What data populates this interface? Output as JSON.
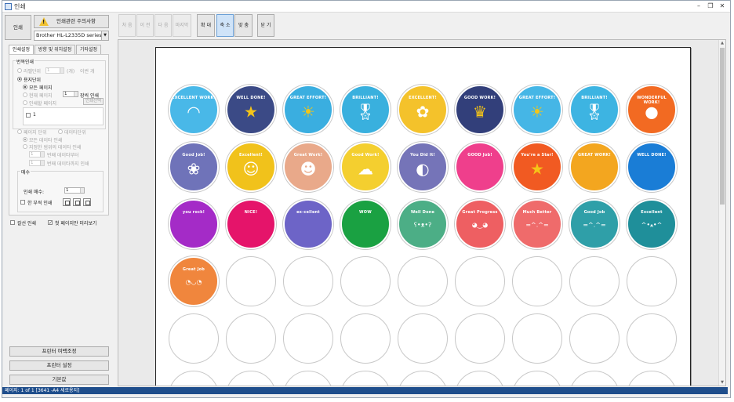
{
  "window": {
    "title": "인쇄",
    "controls": [
      "–",
      "❐",
      "✕"
    ]
  },
  "left": {
    "print_label": "인쇄",
    "notice_label": "인쇄관련 주의사항",
    "printer": "Brother HL-L2335D series[",
    "tabs": [
      "인쇄설정",
      "방향 및 위치설정",
      "기타설정"
    ],
    "range_group": "번복인쇄",
    "label_unit": "라벨단위",
    "label_unit_value": "1",
    "label_unit_suffix": "(개)",
    "label_unit_extra": "이번 개",
    "sheet_unit": "용지단위",
    "all_pages": "모든 페이지",
    "current_page": "현재 페이지",
    "current_page_value": "1",
    "current_page_suffix": "장씩 인쇄",
    "pages_to_print": "인쇄할 페이지",
    "range_button": "인쇄선택",
    "page_input": "1",
    "page_unit": "페이지 단위",
    "data_unit": "데이타단위",
    "all_data": "모든 데이타 인쇄",
    "range_data": "지정한 범위의 데이타 인쇄",
    "from_value": "1",
    "from_suffix": "번째 데이타부터",
    "to_value": "1",
    "to_suffix": "번째 데이타까지 인쇄",
    "copies_group": "매수",
    "copies_label": "인쇄 매수:",
    "copies_value": "1",
    "collate_label": "한 부씩 인쇄",
    "cutline_label": "칼선 인쇄",
    "fit_label": "첫 페이지만 미리보기",
    "buttons": [
      "프린터 여백조정",
      "프린터 설정",
      "기본값"
    ]
  },
  "toolbar": {
    "first": "처 음",
    "prev": "이 전",
    "next": "다 음",
    "last": "마지막",
    "zoom_in": "확 대",
    "zoom_out": "축 소",
    "fit": "맞 춤",
    "close": "닫 기"
  },
  "stickers": {
    "row1": [
      {
        "text": "EXCELLENT WORK!",
        "bg": "#49b8e8",
        "icon": "rainbow-icon"
      },
      {
        "text": "WELL DONE!",
        "bg": "#3b4a86",
        "icon": "star-icon"
      },
      {
        "text": "GREAT EFFORT!",
        "bg": "#3aaee0",
        "icon": "sun-icon"
      },
      {
        "text": "BRILLIANT!",
        "bg": "#39b0de",
        "icon": "medal-icon"
      },
      {
        "text": "EXCELLENT!",
        "bg": "#f4c22b",
        "icon": "flower-icon"
      },
      {
        "text": "GOOD WORK!",
        "bg": "#323f7a",
        "icon": "crown-icon"
      },
      {
        "text": "GREAT EFFORT!",
        "bg": "#45b6e6",
        "icon": "sun-icon"
      },
      {
        "text": "BRILLIANT!",
        "bg": "#3db4e2",
        "icon": "medal-icon"
      },
      {
        "text": "WONDERFUL WORK!",
        "bg": "#f26a22",
        "icon": "apple-icon"
      }
    ],
    "row2": [
      {
        "text": "Good Job!",
        "bg": "#6f73b9",
        "icon": "tulip-icon"
      },
      {
        "text": "Excellent!",
        "bg": "#f1c21b",
        "icon": "girl-face-icon"
      },
      {
        "text": "Great Work!",
        "bg": "#e9a98a",
        "icon": "boy-face-icon"
      },
      {
        "text": "Good Work!",
        "bg": "#f4cf2f",
        "icon": "cloud-icon"
      },
      {
        "text": "You Did It!",
        "bg": "#7574b8",
        "icon": "lemon-icon"
      },
      {
        "text": "GOOD Job!",
        "bg": "#ef3f8c",
        "icon": "none"
      },
      {
        "text": "You're a Star!",
        "bg": "#f15a22",
        "icon": "star-icon"
      },
      {
        "text": "GREAT WORK!",
        "bg": "#f3a61f",
        "icon": "none"
      },
      {
        "text": "WELL DONE!",
        "bg": "#1a7dd6",
        "icon": "none"
      }
    ],
    "row3": [
      {
        "text": "you rock!",
        "bg": "#a42bc7",
        "icon": "none"
      },
      {
        "text": "NICE!",
        "bg": "#e5146a",
        "icon": "none"
      },
      {
        "text": "ex-cellent",
        "bg": "#6d64c7",
        "icon": "none"
      },
      {
        "text": "WOW",
        "bg": "#1aa142",
        "icon": "none"
      },
      {
        "text": "Well Done",
        "bg": "#4cae86",
        "icon": "bear-icon"
      },
      {
        "text": "Great Progress",
        "bg": "#ee5f62",
        "icon": "panda-icon"
      },
      {
        "text": "Much Better",
        "bg": "#ef6b6b",
        "icon": "cat-icon"
      },
      {
        "text": "Good Job",
        "bg": "#2f9fa8",
        "icon": "cat-icon"
      },
      {
        "text": "Excellent",
        "bg": "#1f8f9a",
        "icon": "fox-icon"
      }
    ],
    "row4": [
      {
        "text": "Great Job",
        "bg": "#f0863d",
        "icon": "penguin-icon"
      }
    ]
  },
  "status": "페이지: 1 of 1 [3641 -A4 세로용지]"
}
